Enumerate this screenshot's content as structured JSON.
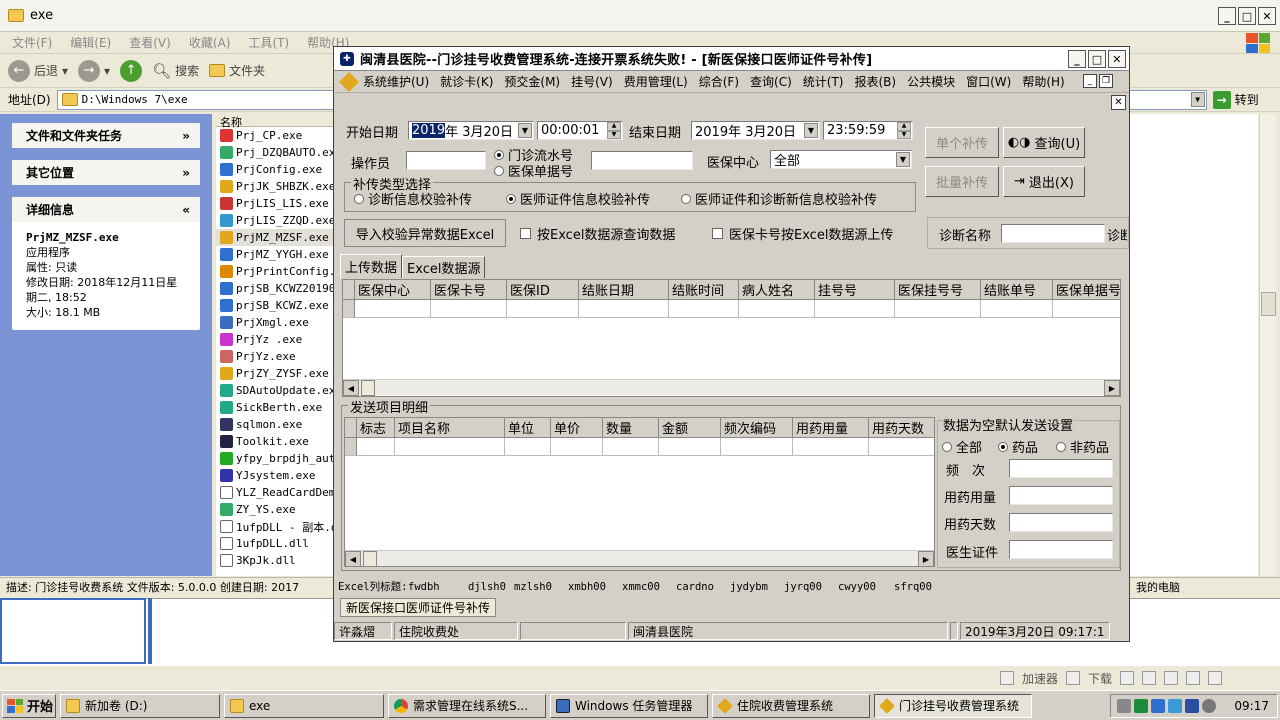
{
  "explorer": {
    "title": "exe",
    "menu": [
      "文件(F)",
      "编辑(E)",
      "查看(V)",
      "收藏(A)",
      "工具(T)",
      "帮助(H)"
    ],
    "toolbar": {
      "back": "后退",
      "search": "搜索",
      "folders": "文件夹"
    },
    "address_label": "地址(D)",
    "address_value": "D:\\Windows 7\\exe",
    "go_label": "转到",
    "tasks": {
      "file_tasks": "文件和文件夹任务",
      "other_places": "其它位置",
      "details": "详细信息",
      "detail_name": "PrjMZ_MZSF.exe",
      "detail_type": "应用程序",
      "detail_attr": "属性: 只读",
      "detail_modified": "修改日期: 2018年12月11日星期二, 18:52",
      "detail_size": "大小: 18.1 MB"
    },
    "column_name": "名称",
    "files": [
      "Prj_CP.exe",
      "Prj_DZQBAUTO.exe",
      "PrjConfig.exe",
      "PrjJK_SHBZK.exe",
      "PrjLIS_LIS.exe",
      "PrjLIS_ZZQD.exe",
      "PrjMZ_MZSF.exe",
      "PrjMZ_YYGH.exe",
      "PrjPrintConfig.exe",
      "prjSB_KCWZ201901",
      "prjSB_KCWZ.exe",
      "PrjXmgl.exe",
      "PrjYz .exe",
      "PrjYz.exe",
      "PrjZY_ZYSF.exe",
      "SDAutoUpdate.exe",
      "SickBerth.exe",
      "sqlmon.exe",
      "Toolkit.exe",
      "yfpy_brpdjh_auto",
      "YJsystem.exe",
      "YLZ_ReadCardDemo",
      "ZY_YS.exe",
      "1ufpDLL - 副本.d",
      "1ufpDLL.dll",
      "3KpJk.dll"
    ],
    "status_text": "描述: 门诊挂号收费系统 文件版本: 5.0.0.0 创建日期: 2017",
    "status_right": "我的电脑",
    "tray_strip": {
      "accel": "加速器",
      "download": "下载"
    }
  },
  "app": {
    "title": "闽清县医院--门诊挂号收费管理系统-连接开票系统失败! - [新医保接口医师证件号补传]",
    "menu": [
      "系统维护(U)",
      "就诊卡(K)",
      "预交金(M)",
      "挂号(V)",
      "费用管理(L)",
      "综合(F)",
      "查询(C)",
      "统计(T)",
      "报表(B)",
      "公共模块",
      "窗口(W)",
      "帮助(H)"
    ],
    "form": {
      "start_date_label": "开始日期",
      "start_date_year": "2019",
      "start_date_rest": "年 3月20日",
      "start_time": "00:00:01",
      "end_date_label": "结束日期",
      "end_date": "2019年 3月20日",
      "end_time": "23:59:59",
      "operator_label": "操作员",
      "operator_value": "",
      "radio_flow": "门诊流水号",
      "radio_bill": "医保单据号",
      "flow_value": "",
      "center_label": "医保中心",
      "center_value": "全部",
      "type_group": "补传类型选择",
      "type_opt1": "诊断信息校验补传",
      "type_opt2": "医师证件信息校验补传",
      "type_opt3": "医师证件和诊断新信息校验补传",
      "btn_single": "单个补传",
      "btn_query": "查询(U)",
      "btn_batch": "批量补传",
      "btn_exit": "退出(X)",
      "btn_import": "导入校验异常数据Excel",
      "chk_excel_query": "按Excel数据源查询数据",
      "chk_card_upload": "医保卡号按Excel数据源上传",
      "diag_label": "诊断名称",
      "diag_value": "",
      "diag_label2": "诊断"
    },
    "tabs": [
      "上传数据",
      "Excel数据源"
    ],
    "upload_columns": [
      "医保中心",
      "医保卡号",
      "医保ID",
      "结账日期",
      "结账时间",
      "病人姓名",
      "挂号号",
      "医保挂号号",
      "结账单号",
      "医保单据号"
    ],
    "detail_group": "发送项目明细",
    "detail_columns": [
      "标志",
      "项目名称",
      "单位",
      "单价",
      "数量",
      "金额",
      "频次编码",
      "用药用量",
      "用药天数"
    ],
    "default_group": "数据为空默认发送设置",
    "default_radio": [
      "全部",
      "药品",
      "非药品"
    ],
    "freq_label": "频　次",
    "dose_label": "用药用量",
    "days_label": "用药天数",
    "doctor_label": "医生证件",
    "excel_cols_label": "Excel列标题:",
    "excel_cols": [
      "fwdbh",
      "djlsh0",
      "mzlsh0",
      "xmbh00",
      "xmmc00",
      "cardno",
      "jydybm",
      "jyrq00",
      "cwyy00",
      "sfrq00"
    ],
    "doc_tab": "新医保接口医师证件号补传",
    "status": [
      "许淼熠",
      "住院收费处",
      "",
      "闽清县医院",
      "",
      "2019年3月20日 09:17:1"
    ]
  },
  "taskbar": {
    "start": "开始",
    "tasks": [
      "新加卷 (D:)",
      "exe",
      "需求管理在线系统S...",
      "Windows 任务管理器",
      "住院收费管理系统",
      "门诊挂号收费管理系统"
    ],
    "clock": "09:17"
  },
  "colors": {
    "title_highlight": "#0a246a",
    "xp_blue": "#7b94d6",
    "window_face": "#d4d0c8"
  }
}
